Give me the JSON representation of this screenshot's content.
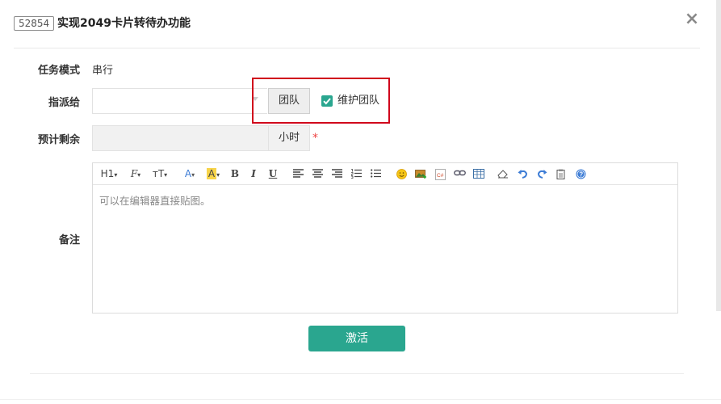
{
  "header": {
    "task_id": "52854",
    "title": "实现2049卡片转待办功能",
    "close_label": "×"
  },
  "form": {
    "mode_label": "任务模式",
    "mode_value": "串行",
    "assign_label": "指派给",
    "assign_value": "",
    "team_button": "团队",
    "maintain_team_label": "维护团队",
    "maintain_team_checked": true,
    "remain_label": "预计剩余",
    "remain_value": "",
    "remain_unit": "小时",
    "required_mark": "*",
    "notes_label": "备注",
    "notes_placeholder": "可以在编辑器直接贴图。"
  },
  "editor_toolbar": {
    "heading": "H1",
    "font_family": "F",
    "font_size": "тT",
    "font_color": "A",
    "bg_color": "A",
    "bold": "B",
    "italic": "I",
    "underline": "U",
    "icons": [
      "align-left-icon",
      "align-center-icon",
      "align-right-icon",
      "ordered-list-icon",
      "unordered-list-icon",
      "emoji-icon",
      "image-icon",
      "code-icon",
      "link-icon",
      "table-icon",
      "eraser-icon",
      "undo-icon",
      "redo-icon",
      "paste-icon",
      "help-icon"
    ]
  },
  "submit_label": "激活",
  "colors": {
    "accent": "#2aa68f",
    "highlight": "#d0021b",
    "required": "#e44444"
  }
}
